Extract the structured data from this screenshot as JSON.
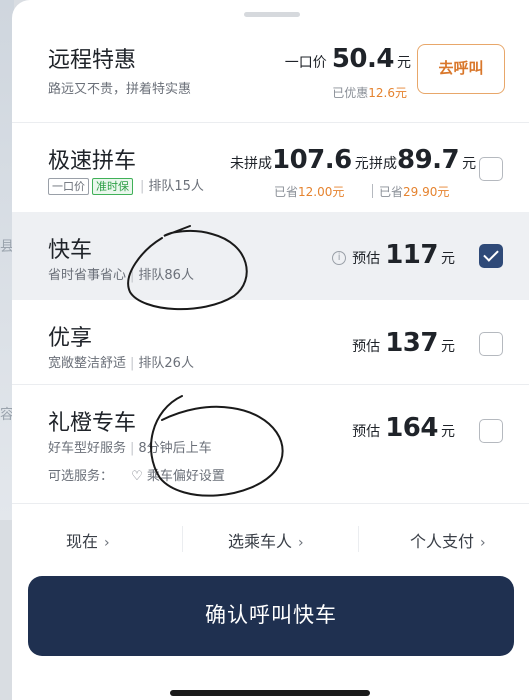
{
  "map": {
    "glyphs": [
      "县",
      "容"
    ]
  },
  "options": [
    {
      "title": "远程特惠",
      "subtitle": "路远又不贵，拼着特实惠",
      "price_label": "一口价",
      "price": "50.4",
      "unit": "元",
      "saved_label": "已优惠",
      "saved_amount": "12.6元",
      "call_button": "去呼叫"
    },
    {
      "title": "极速拼车",
      "tags": [
        "一口价",
        "准时保"
      ],
      "queue": "排队15人",
      "price_a_label": "未拼成",
      "price_a": "107.6",
      "price_a_unit": "元",
      "saved_a_label": "已省",
      "saved_a": "12.00元",
      "price_b_label": "拼成",
      "price_b": "89.7",
      "price_b_unit": "元",
      "saved_b_label": "已省",
      "saved_b": "29.90元",
      "checked": false
    },
    {
      "title": "快车",
      "desc": "省时省事省心",
      "queue": "排队86人",
      "price_label": "预估",
      "price": "117",
      "unit": "元",
      "checked": true
    },
    {
      "title": "优享",
      "desc": "宽敞整洁舒适",
      "queue": "排队26人",
      "price_label": "预估",
      "price": "137",
      "unit": "元",
      "checked": false
    },
    {
      "title": "礼橙专车",
      "desc": "好车型好服务",
      "eta": "8分钟后上车",
      "services_label": "可选服务：",
      "preference": "乘车偏好设置",
      "price_label": "预估",
      "price": "164",
      "unit": "元",
      "checked": false
    }
  ],
  "footer": {
    "time": "现在",
    "passenger": "选乘车人",
    "payment": "个人支付",
    "chevron": "›",
    "confirm": "确认呼叫快车"
  },
  "icons": {
    "info": "i",
    "heart": "♡"
  },
  "colors": {
    "accent": "#1f3050",
    "orange": "#e5832f",
    "green": "#30a048"
  }
}
